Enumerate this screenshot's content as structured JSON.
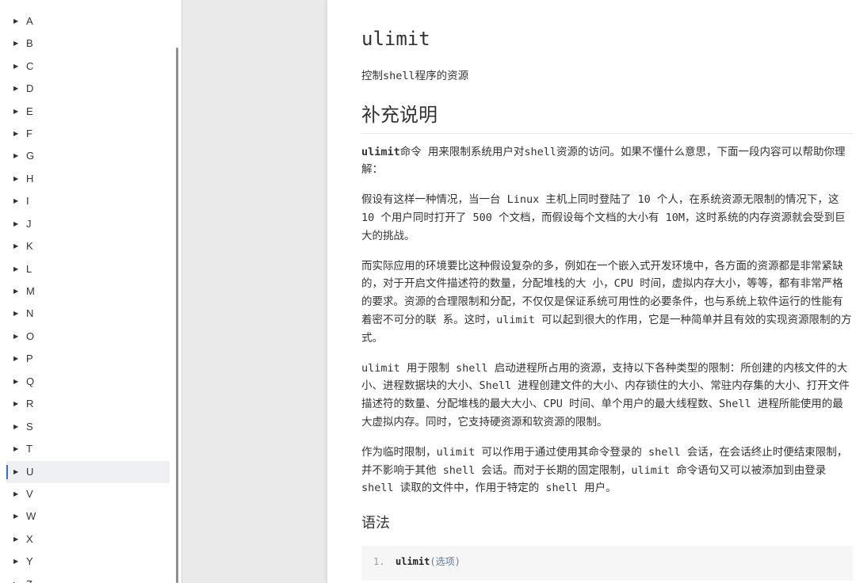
{
  "sidebar": {
    "item_icon": "caret-right-icon",
    "items": [
      {
        "label": "A"
      },
      {
        "label": "B"
      },
      {
        "label": "C"
      },
      {
        "label": "D"
      },
      {
        "label": "E"
      },
      {
        "label": "F"
      },
      {
        "label": "G"
      },
      {
        "label": "H"
      },
      {
        "label": "I"
      },
      {
        "label": "J"
      },
      {
        "label": "K"
      },
      {
        "label": "L"
      },
      {
        "label": "M"
      },
      {
        "label": "N"
      },
      {
        "label": "O"
      },
      {
        "label": "P"
      },
      {
        "label": "Q"
      },
      {
        "label": "R"
      },
      {
        "label": "S"
      },
      {
        "label": "T"
      },
      {
        "label": "U",
        "active": true
      },
      {
        "label": "V"
      },
      {
        "label": "W"
      },
      {
        "label": "X"
      },
      {
        "label": "Y"
      },
      {
        "label": "Z"
      }
    ]
  },
  "article": {
    "title": "ulimit",
    "description": "控制shell程序的资源",
    "section_heading": "补充说明",
    "intro": {
      "command": "ulimit",
      "text": "命令 用来限制系统用户对shell资源的访问。如果不懂什么意思，下面一段内容可以帮助你理解："
    },
    "paragraphs": [
      "假设有这样一种情况，当一台 Linux 主机上同时登陆了 10 个人，在系统资源无限制的情况下，这 10 个用户同时打开了 500 个文档，而假设每个文档的大小有 10M，这时系统的内存资源就会受到巨大的挑战。",
      "而实际应用的环境要比这种假设复杂的多，例如在一个嵌入式开发环境中，各方面的资源都是非常紧缺的，对于开启文件描述符的数量，分配堆栈的大 小，CPU 时间，虚拟内存大小，等等，都有非常严格的要求。资源的合理限制和分配，不仅仅是保证系统可用性的必要条件，也与系统上软件运行的性能有着密不可分的联 系。这时，ulimit 可以起到很大的作用，它是一种简单并且有效的实现资源限制的方式。",
      "ulimit 用于限制 shell 启动进程所占用的资源，支持以下各种类型的限制：所创建的内核文件的大小、进程数据块的大小、Shell 进程创建文件的大小、内存锁住的大小、常驻内存集的大小、打开文件描述符的数量、分配堆栈的最大大小、CPU 时间、单个用户的最大线程数、Shell 进程所能使用的最大虚拟内存。同时，它支持硬资源和软资源的限制。",
      "作为临时限制，ulimit 可以作用于通过使用其命令登录的 shell 会话，在会话终止时便结束限制，并不影响于其他 shell 会话。而对于长期的固定限制，ulimit 命令语句又可以被添加到由登录 shell 读取的文件中，作用于特定的 shell 用户。"
    ],
    "syntax_heading": "语法",
    "syntax_code": {
      "line_number": "1.",
      "command": "ulimit",
      "arguments": "(选项)"
    }
  },
  "colors": {
    "accent": "#2f6fd1",
    "active_background": "#eef0f3",
    "code_background": "#f6f6f6",
    "code_arguments": "#5c7a99"
  }
}
